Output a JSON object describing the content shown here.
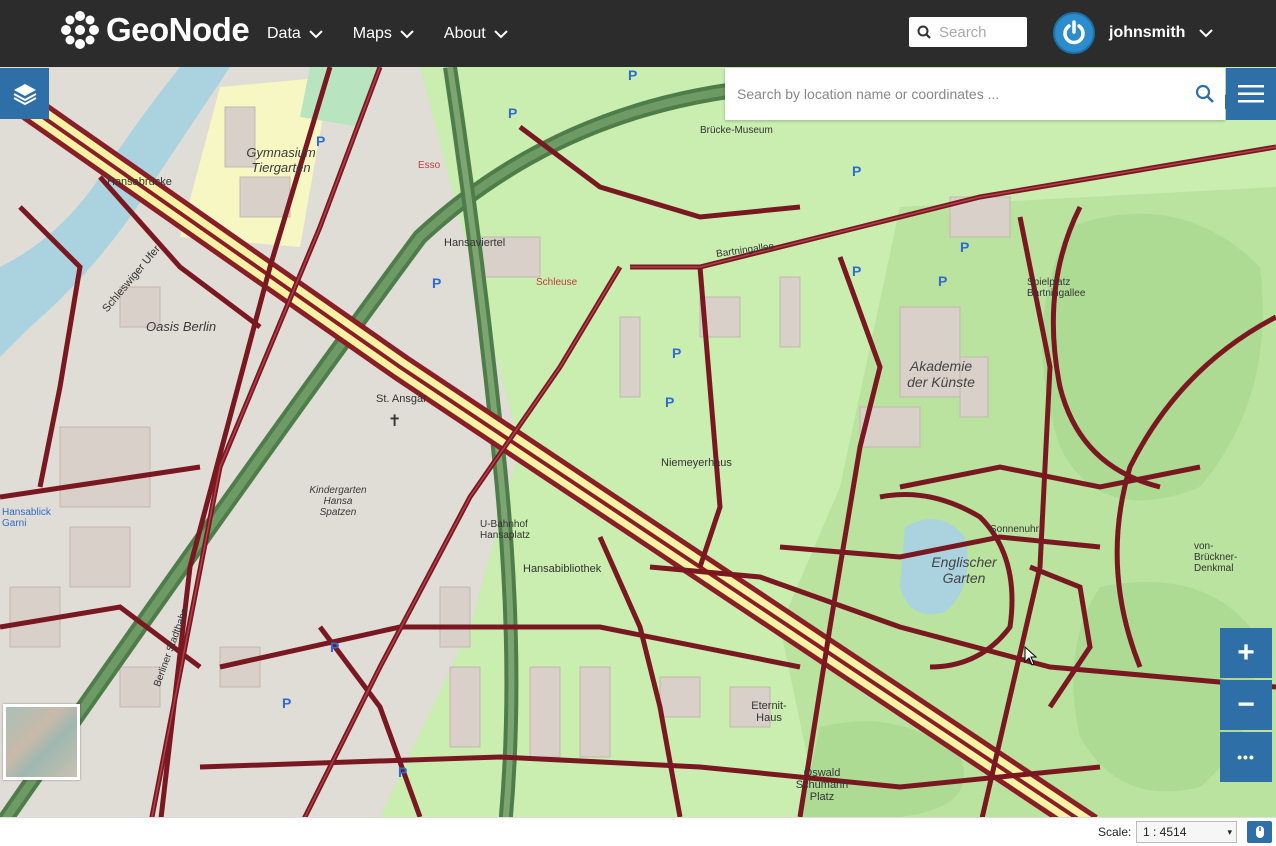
{
  "app": {
    "brand": "GeoNode"
  },
  "nav": {
    "items": [
      {
        "label": "Data"
      },
      {
        "label": "Maps"
      },
      {
        "label": "About"
      }
    ],
    "search_placeholder": "Search",
    "user": "johnsmith"
  },
  "map": {
    "location_search_placeholder": "Search by location name or coordinates ...",
    "labels": {
      "hansabruecke": "Hansabrücke",
      "gymnasium": "Gymnasium Tiergarten",
      "oasis": "Oasis Berlin",
      "akademie": "Akademie der Künste",
      "englischer": "Englischer Garten",
      "st_ansgar": "St. Ansgar",
      "kindergarten": "Kindergarten Hansa Spatzen",
      "hansabibliothek": "Hansabibliothek",
      "niemeyerhaus": "Niemeyerhaus",
      "eternit": "Eternit-Haus",
      "oswald": "Oswald Schumann Platz",
      "spielplatz": "Spielplatz Bartningallee",
      "hansablick": "Hansablick Garni",
      "esso": "Esso",
      "sonnenuhr": "Sonnenuhr",
      "bruecken_denkmal": "von-Brückner-Denkmal",
      "schleswiger_ufer": "Schleswiger Ufer",
      "berliner_stadtbahn": "Berliner Stadtbahn",
      "hansaviertel": "Hansaviertel",
      "museum": "Brücke-Museum",
      "bartningallee": "Bartningallee",
      "u_bahnhof": "U-Bahnhof Hansaplatz",
      "schleuse": "Schleuse"
    }
  },
  "controls": {
    "zoom_in": "+",
    "zoom_out": "−",
    "more": "•••"
  },
  "footer": {
    "scale_label": "Scale:",
    "scale_value": "1 : 4514"
  }
}
